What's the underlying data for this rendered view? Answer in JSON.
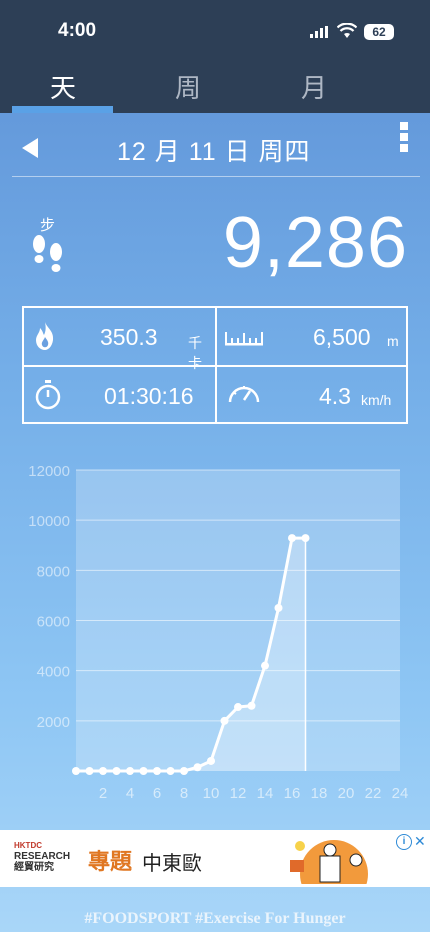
{
  "status_bar": {
    "time": "4:00",
    "battery": "62"
  },
  "tabs": [
    {
      "label": "天",
      "active": true
    },
    {
      "label": "周",
      "active": false
    },
    {
      "label": "月",
      "active": false
    }
  ],
  "date": {
    "label": "12 月 11 日 周四"
  },
  "steps": {
    "label": "步",
    "value": "9,286"
  },
  "stats": {
    "calories": {
      "value": "350.3",
      "unit": "千卡"
    },
    "distance": {
      "value": "6,500",
      "unit": "m"
    },
    "duration": {
      "value": "01:30:16"
    },
    "speed": {
      "value": "4.3",
      "unit": "km/h"
    }
  },
  "chart_data": {
    "type": "line",
    "ylim": [
      0,
      12000
    ],
    "xlim": [
      0,
      24
    ],
    "y_ticks": [
      "2000",
      "4000",
      "6000",
      "8000",
      "10000",
      "12000"
    ],
    "x_ticks": [
      "2",
      "4",
      "6",
      "8",
      "10",
      "12",
      "14",
      "16",
      "18",
      "20",
      "22",
      "24"
    ],
    "x": [
      0,
      1,
      2,
      3,
      4,
      5,
      6,
      7,
      8,
      9,
      10,
      11,
      12,
      13,
      14,
      15,
      16,
      17
    ],
    "values": [
      0,
      0,
      0,
      0,
      0,
      0,
      0,
      0,
      0,
      150,
      400,
      2000,
      2550,
      2600,
      4200,
      6500,
      9286,
      9286
    ]
  },
  "ad": {
    "brand_line1": "HKTDC",
    "brand_line2": "RESEARCH",
    "brand_line3": "經貿研究",
    "topic": "專題",
    "region": "中東歐"
  },
  "footer": {
    "text": "#FOODSPORT #Exercise For Hunger"
  },
  "colors": {
    "header_bg": "#2d3f56",
    "tab_accent": "#5aa1e6",
    "ad_accent": "#e07722"
  }
}
